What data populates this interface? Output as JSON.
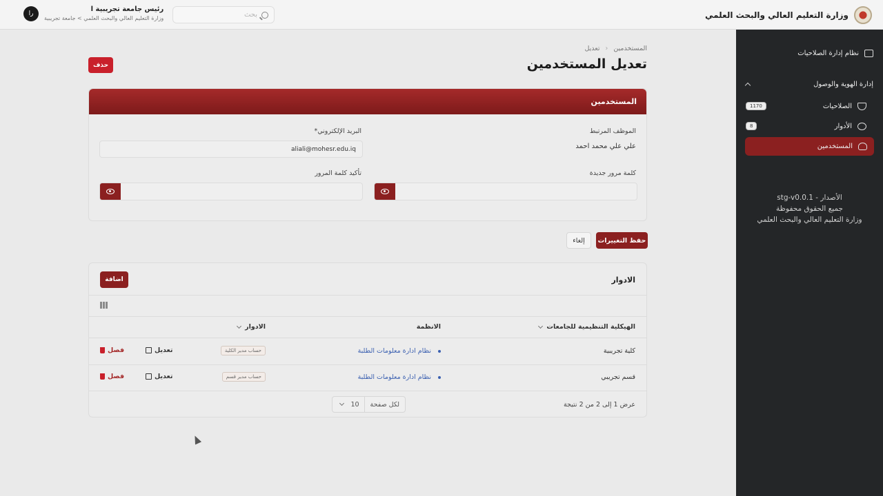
{
  "header": {
    "brand_title": "وزارة التعليم العالي والبحث العلمي",
    "search_placeholder": "بحث",
    "user": {
      "initials": "را",
      "name": "رئيس جامعة تجريبية ا",
      "subtitle": "وزارة التعليم العالي والبحث العلمي > جامعة تجريبية"
    }
  },
  "sidebar": {
    "system_title": "نظام إدارة الصلاحيات",
    "section_title": "إدارة الهوية والوصول",
    "items": [
      {
        "label": "الصلاحيات",
        "badge": "1170",
        "icon": "shield-icon"
      },
      {
        "label": "الأدوار",
        "badge": "8",
        "icon": "fingerprint-icon"
      },
      {
        "label": "المستخدمين",
        "badge": "",
        "icon": "users-icon",
        "active": true
      }
    ],
    "version_line1": "الأصدار - stg-v0.0.1",
    "version_line2": "جميع الحقوق محفوظة",
    "version_line3": "وزارة التعليم العالي والبحث العلمي"
  },
  "page": {
    "breadcrumb_parent": "المستخدمين",
    "breadcrumb_current": "تعديل",
    "title": "تعديل المستخدمين",
    "delete_label": "حذف"
  },
  "form": {
    "card_title": "المستخدمين",
    "employee_label": "الموظف المرتبط",
    "employee_value": "علي علي محمد احمد",
    "email_label": "البريد الإلكتروني*",
    "email_value": "aliali@mohesr.edu.iq",
    "new_password_label": "كلمة مرور جديدة",
    "confirm_password_label": "تأكيد كلمة المرور",
    "save_label": "حفظ التغييرات",
    "cancel_label": "إلغاء"
  },
  "roles": {
    "title": "الادوار",
    "add_label": "اضافة",
    "columns": [
      "الهيكلية التنظيمية للجامعات",
      "الانظمة",
      "الادوار"
    ],
    "rows": [
      {
        "org": "كلية تجريبية",
        "system": "نظام ادارة معلومات الطلبة",
        "role": "حساب مدير الكلية",
        "edit": "تعديل",
        "unlink": "فصل"
      },
      {
        "org": "قسم تجريبي",
        "system": "نظام ادارة معلومات الطلبة",
        "role": "حساب مدير قسم",
        "edit": "تعديل",
        "unlink": "فصل"
      }
    ],
    "pagination_text": "عرض 1 إلى 2 من 2 نتيجة",
    "per_page_label": "لكل صفحة",
    "per_page_value": "10"
  }
}
